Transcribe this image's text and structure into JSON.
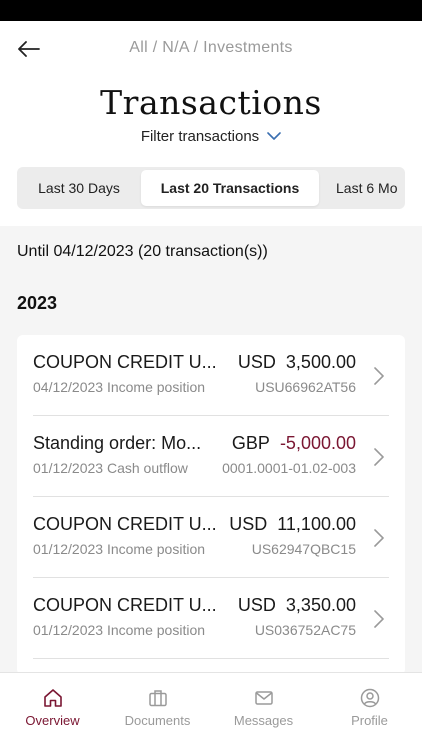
{
  "header": {
    "breadcrumb": "All / N/A / Investments",
    "title": "Transactions",
    "filter_label": "Filter transactions"
  },
  "tabs": [
    {
      "label": "Last 30 Days"
    },
    {
      "label": "Last 20 Transactions",
      "selected": true
    },
    {
      "label": "Last 6 Mo"
    }
  ],
  "summary": {
    "until": "Until 04/12/2023 (20 transaction(s))",
    "year": "2023"
  },
  "transactions": [
    {
      "title": "COUPON CREDIT U...",
      "currency": "USD",
      "amount": "3,500.00",
      "sub": "04/12/2023 Income position",
      "ref": "USU66962AT56"
    },
    {
      "title": "Standing order: Mo...",
      "currency": "GBP",
      "amount": "-5,000.00",
      "sub": "01/12/2023 Cash outflow",
      "ref": "0001.0001-01.02-003"
    },
    {
      "title": "COUPON CREDIT U...",
      "currency": "USD",
      "amount": "11,100.00",
      "sub": "01/12/2023 Income position",
      "ref": "US62947QBC15"
    },
    {
      "title": "COUPON CREDIT U...",
      "currency": "USD",
      "amount": "3,350.00",
      "sub": "01/12/2023 Income position",
      "ref": "US036752AC75"
    }
  ],
  "nav": [
    {
      "label": "Overview",
      "icon": "home-icon",
      "active": true
    },
    {
      "label": "Documents",
      "icon": "briefcase-icon"
    },
    {
      "label": "Messages",
      "icon": "envelope-icon"
    },
    {
      "label": "Profile",
      "icon": "user-icon"
    }
  ],
  "colors": {
    "accent": "#7a1632",
    "negative": "#7a1632",
    "filter_chevron": "#3a6fb0"
  }
}
